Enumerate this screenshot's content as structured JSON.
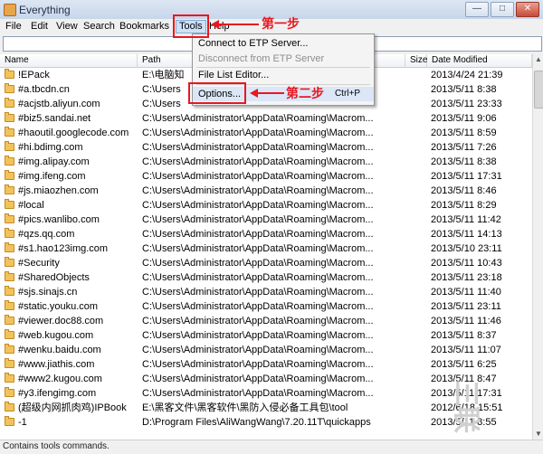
{
  "window": {
    "title": "Everything"
  },
  "menu": [
    "File",
    "Edit",
    "View",
    "Search",
    "Bookmarks",
    "Tools",
    "Help"
  ],
  "search": {
    "value": "",
    "placeholder": ""
  },
  "columns": [
    "Name",
    "Path",
    "Size",
    "Date Modified"
  ],
  "rows": [
    {
      "name": "!EPack",
      "path": "E:\\电脑知",
      "size": "",
      "date": "2013/4/24 21:39"
    },
    {
      "name": "#a.tbcdn.cn",
      "path": "C:\\Users",
      "size": "",
      "date": "2013/5/11 8:38"
    },
    {
      "name": "#acjstb.aliyun.com",
      "path": "C:\\Users",
      "size": "",
      "date": "2013/5/11 23:33"
    },
    {
      "name": "#biz5.sandai.net",
      "path": "C:\\Users\\Administrator\\AppData\\Roaming\\Macrom...",
      "size": "",
      "date": "2013/5/11 9:06"
    },
    {
      "name": "#haoutil.googlecode.com",
      "path": "C:\\Users\\Administrator\\AppData\\Roaming\\Macrom...",
      "size": "",
      "date": "2013/5/11 8:59"
    },
    {
      "name": "#hi.bdimg.com",
      "path": "C:\\Users\\Administrator\\AppData\\Roaming\\Macrom...",
      "size": "",
      "date": "2013/5/11 7:26"
    },
    {
      "name": "#img.alipay.com",
      "path": "C:\\Users\\Administrator\\AppData\\Roaming\\Macrom...",
      "size": "",
      "date": "2013/5/11 8:38"
    },
    {
      "name": "#img.ifeng.com",
      "path": "C:\\Users\\Administrator\\AppData\\Roaming\\Macrom...",
      "size": "",
      "date": "2013/5/11 17:31"
    },
    {
      "name": "#js.miaozhen.com",
      "path": "C:\\Users\\Administrator\\AppData\\Roaming\\Macrom...",
      "size": "",
      "date": "2013/5/11 8:46"
    },
    {
      "name": "#local",
      "path": "C:\\Users\\Administrator\\AppData\\Roaming\\Macrom...",
      "size": "",
      "date": "2013/5/11 8:29"
    },
    {
      "name": "#pics.wanlibo.com",
      "path": "C:\\Users\\Administrator\\AppData\\Roaming\\Macrom...",
      "size": "",
      "date": "2013/5/11 11:42"
    },
    {
      "name": "#qzs.qq.com",
      "path": "C:\\Users\\Administrator\\AppData\\Roaming\\Macrom...",
      "size": "",
      "date": "2013/5/11 14:13"
    },
    {
      "name": "#s1.hao123img.com",
      "path": "C:\\Users\\Administrator\\AppData\\Roaming\\Macrom...",
      "size": "",
      "date": "2013/5/10 23:11"
    },
    {
      "name": "#Security",
      "path": "C:\\Users\\Administrator\\AppData\\Roaming\\Macrom...",
      "size": "",
      "date": "2013/5/11 10:43"
    },
    {
      "name": "#SharedObjects",
      "path": "C:\\Users\\Administrator\\AppData\\Roaming\\Macrom...",
      "size": "",
      "date": "2013/5/11 23:18"
    },
    {
      "name": "#sjs.sinajs.cn",
      "path": "C:\\Users\\Administrator\\AppData\\Roaming\\Macrom...",
      "size": "",
      "date": "2013/5/11 11:40"
    },
    {
      "name": "#static.youku.com",
      "path": "C:\\Users\\Administrator\\AppData\\Roaming\\Macrom...",
      "size": "",
      "date": "2013/5/11 23:11"
    },
    {
      "name": "#viewer.doc88.com",
      "path": "C:\\Users\\Administrator\\AppData\\Roaming\\Macrom...",
      "size": "",
      "date": "2013/5/11 11:46"
    },
    {
      "name": "#web.kugou.com",
      "path": "C:\\Users\\Administrator\\AppData\\Roaming\\Macrom...",
      "size": "",
      "date": "2013/5/11 8:37"
    },
    {
      "name": "#wenku.baidu.com",
      "path": "C:\\Users\\Administrator\\AppData\\Roaming\\Macrom...",
      "size": "",
      "date": "2013/5/11 11:07"
    },
    {
      "name": "#www.jiathis.com",
      "path": "C:\\Users\\Administrator\\AppData\\Roaming\\Macrom...",
      "size": "",
      "date": "2013/5/11 6:25"
    },
    {
      "name": "#www2.kugou.com",
      "path": "C:\\Users\\Administrator\\AppData\\Roaming\\Macrom...",
      "size": "",
      "date": "2013/5/11 8:47"
    },
    {
      "name": "#y3.ifengimg.com",
      "path": "C:\\Users\\Administrator\\AppData\\Roaming\\Macrom...",
      "size": "",
      "date": "2013/5/11 17:31"
    },
    {
      "name": "(超级内网抓肉鸡)IPBook",
      "path": "E:\\黑客文件\\黑客软件\\黑防入侵必备工具包\\tool",
      "size": "",
      "date": "2012/6/18 15:51"
    },
    {
      "name": "-1",
      "path": "D:\\Program Files\\AliWangWang\\7.20.11T\\quickapps",
      "size": "",
      "date": "2013/5/11 8:55"
    }
  ],
  "tools_menu": {
    "items": [
      {
        "label": "Connect to ETP Server...",
        "disabled": false,
        "shortcut": ""
      },
      {
        "label": "Disconnect from ETP Server",
        "disabled": true,
        "shortcut": ""
      },
      {
        "label": "File List Editor...",
        "disabled": false,
        "shortcut": ""
      },
      {
        "label": "Options...",
        "disabled": false,
        "shortcut": "Ctrl+P"
      }
    ]
  },
  "annotations": {
    "step1": "第一步",
    "step2": "第二步"
  },
  "status": "Contains tools commands.",
  "watermark": "三联",
  "colors": {
    "annotation": "#e8171f",
    "folder": "#f2c35b",
    "menu_highlight": "#cfe0f6"
  }
}
